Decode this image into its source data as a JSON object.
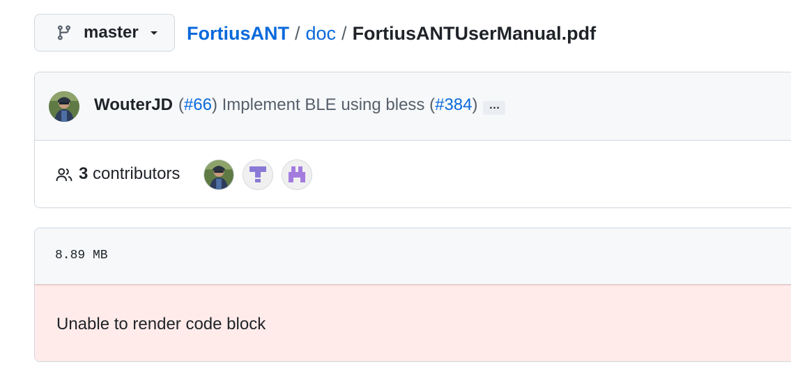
{
  "branch": {
    "icon": "git-branch-icon",
    "label": "master",
    "caret_icon": "triangle-down-icon"
  },
  "breadcrumb": {
    "repo": "FortiusANT",
    "separator": "/",
    "folder": "doc",
    "file": "FortiusANTUserManual.pdf"
  },
  "commit": {
    "author": "WouterJD",
    "message_open": "(",
    "message_issue": "#66",
    "message_mid": ") Implement BLE using bless (",
    "message_pr": "#384",
    "message_close": ")",
    "ellipsis": "…"
  },
  "contributors": {
    "icon": "people-icon",
    "count": "3",
    "label": "contributors"
  },
  "file": {
    "size": "8.89 MB",
    "error": "Unable to render code block"
  },
  "colors": {
    "link": "#0969da",
    "muted": "#57606a",
    "error_bg": "#ffebe9",
    "identicon_purple": "#8a7ad6"
  }
}
